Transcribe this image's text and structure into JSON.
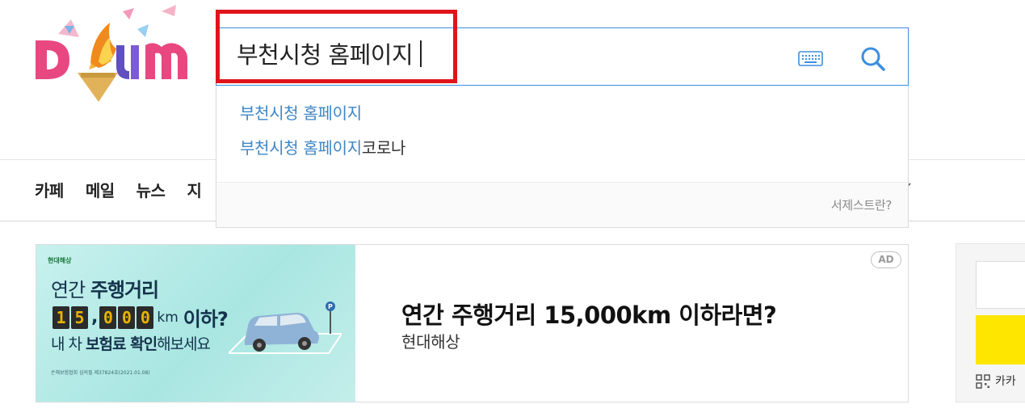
{
  "search": {
    "query": "부천시청 홈페이지"
  },
  "suggestions": {
    "items": [
      {
        "highlight": "부천시청 홈페이지",
        "rest": ""
      },
      {
        "highlight": "부천시청 홈페이지",
        "rest": "코로나"
      }
    ],
    "footer_link": "서제스트란?"
  },
  "nav": {
    "items": [
      "카페",
      "메일",
      "뉴스",
      "지"
    ]
  },
  "ad": {
    "badge": "AD",
    "title": "연간 주행거리 15,000km 이하라면?",
    "advertiser": "현대해상",
    "banner": {
      "brand": "현대해상",
      "headline_prefix": "연간",
      "headline_bold": "주행거리",
      "digits": [
        "1",
        "5",
        ",",
        "0",
        "0",
        "0"
      ],
      "km": "km",
      "iha": "이하?",
      "sub_prefix": "내 차",
      "sub_bold": "보험료 확인",
      "sub_suffix": "해보세요",
      "note": "손해보험협회 심의필 제37824호(2021.01.08)"
    }
  },
  "side": {
    "label": "카카"
  },
  "colors": {
    "search_border": "#3b8ee0",
    "highlight_box": "#e0141c",
    "suggest_match": "#3d86c6",
    "side_yellow": "#ffe600"
  },
  "icons": [
    "daum-logo",
    "keyboard-icon",
    "search-icon",
    "chevron-down-icon",
    "car-icon",
    "qr-icon"
  ]
}
